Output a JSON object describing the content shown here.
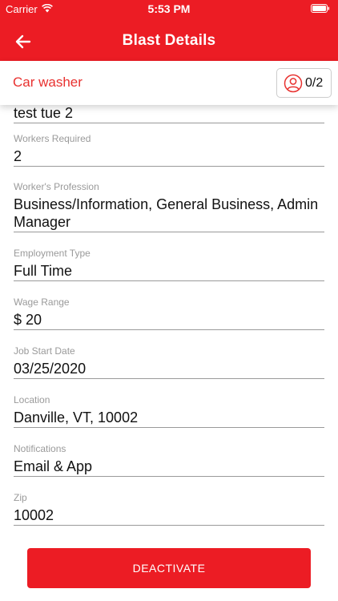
{
  "status_bar": {
    "carrier": "Carrier",
    "time": "5:53 PM"
  },
  "header": {
    "title": "Blast Details",
    "back_icon": "arrow-left-icon",
    "color": "#ec1c24"
  },
  "subheader": {
    "job_name": "Car washer",
    "worker_count": "0/2",
    "count_icon": "person-icon"
  },
  "form": {
    "job_title_value": "test tue 2",
    "fields": [
      {
        "label": "Workers Required",
        "value": "2"
      },
      {
        "label": "Worker's Profession",
        "value": "Business/Information, General Business, Admin Manager"
      },
      {
        "label": "Employment Type",
        "value": "Full Time"
      },
      {
        "label": "Wage Range",
        "value": "$ 20"
      },
      {
        "label": "Job Start Date",
        "value": "03/25/2020"
      },
      {
        "label": "Location",
        "value": "Danville, VT, 10002"
      },
      {
        "label": "Notifications",
        "value": "Email & App"
      },
      {
        "label": "Zip",
        "value": "10002"
      }
    ]
  },
  "actions": {
    "deactivate_label": "DEACTIVATE"
  }
}
